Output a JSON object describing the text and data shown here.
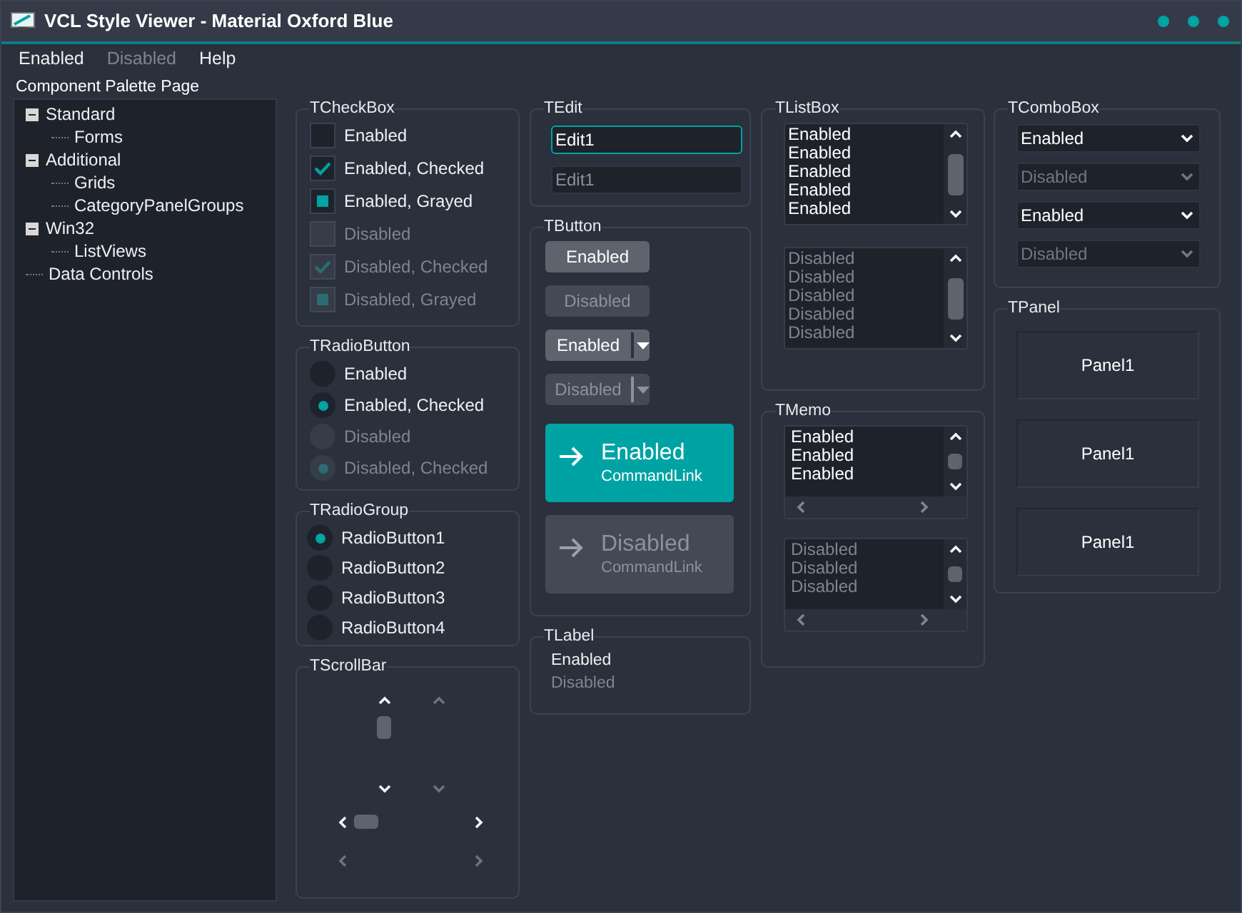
{
  "window": {
    "title": "VCL Style Viewer - Material Oxford Blue"
  },
  "menu": [
    {
      "label": "Enabled",
      "disabled": false
    },
    {
      "label": "Disabled",
      "disabled": true
    },
    {
      "label": "Help",
      "disabled": false
    }
  ],
  "tree": {
    "title": "Component Palette Page",
    "items": [
      {
        "label": "Standard",
        "expanded": true,
        "children": [
          {
            "label": "Forms"
          }
        ]
      },
      {
        "label": "Additional",
        "expanded": true,
        "children": [
          {
            "label": "Grids"
          },
          {
            "label": "CategoryPanelGroups"
          }
        ]
      },
      {
        "label": "Win32",
        "expanded": true,
        "children": [
          {
            "label": "ListViews"
          }
        ]
      },
      {
        "label": "Data Controls"
      }
    ]
  },
  "checkboxes": {
    "title": "TCheckBox",
    "items": [
      {
        "label": "Enabled",
        "checked": false,
        "grayed": false,
        "disabled": false
      },
      {
        "label": "Enabled, Checked",
        "checked": true,
        "grayed": false,
        "disabled": false
      },
      {
        "label": "Enabled, Grayed",
        "checked": false,
        "grayed": true,
        "disabled": false
      },
      {
        "label": "Disabled",
        "checked": false,
        "grayed": false,
        "disabled": true
      },
      {
        "label": "Disabled, Checked",
        "checked": true,
        "grayed": false,
        "disabled": true
      },
      {
        "label": "Disabled, Grayed",
        "checked": false,
        "grayed": true,
        "disabled": true
      }
    ]
  },
  "radio_buttons": {
    "title": "TRadioButton",
    "items": [
      {
        "label": "Enabled",
        "selected": false,
        "disabled": false
      },
      {
        "label": "Enabled, Checked",
        "selected": true,
        "disabled": false
      },
      {
        "label": "Disabled",
        "selected": false,
        "disabled": true
      },
      {
        "label": "Disabled, Checked",
        "selected": true,
        "disabled": true
      }
    ]
  },
  "radio_group": {
    "title": "TRadioGroup",
    "items": [
      {
        "label": "RadioButton1",
        "selected": true
      },
      {
        "label": "RadioButton2",
        "selected": false
      },
      {
        "label": "RadioButton3",
        "selected": false
      },
      {
        "label": "RadioButton4",
        "selected": false
      }
    ]
  },
  "scroll_bars": {
    "title": "TScrollBar",
    "vertical": [
      {
        "disabled": false
      },
      {
        "disabled": true
      }
    ],
    "horizontal": [
      {
        "disabled": false
      },
      {
        "disabled": true
      }
    ]
  },
  "edits": {
    "title": "TEdit",
    "items": [
      {
        "value": "Edit1",
        "focused": true,
        "disabled": false
      },
      {
        "value": "Edit1",
        "focused": false,
        "disabled": true
      }
    ]
  },
  "buttons": {
    "title": "TButton",
    "items": [
      {
        "kind": "push",
        "label": "Enabled",
        "disabled": false
      },
      {
        "kind": "push",
        "label": "Disabled",
        "disabled": true
      },
      {
        "kind": "split",
        "label": "Enabled",
        "disabled": false
      },
      {
        "kind": "split",
        "label": "Disabled",
        "disabled": true
      },
      {
        "kind": "command_link",
        "label": "Enabled",
        "note": "CommandLink",
        "disabled": false
      },
      {
        "kind": "command_link",
        "label": "Disabled",
        "note": "CommandLink",
        "disabled": true
      }
    ]
  },
  "labels": {
    "title": "TLabel",
    "items": [
      {
        "text": "Enabled",
        "disabled": false
      },
      {
        "text": "Disabled",
        "disabled": true
      }
    ]
  },
  "list_boxes": {
    "title": "TListBox",
    "items": [
      {
        "disabled": false,
        "lines": [
          "Enabled",
          "Enabled",
          "Enabled",
          "Enabled",
          "Enabled"
        ]
      },
      {
        "disabled": true,
        "lines": [
          "Disabled",
          "Disabled",
          "Disabled",
          "Disabled",
          "Disabled"
        ]
      }
    ]
  },
  "memos": {
    "title": "TMemo",
    "items": [
      {
        "disabled": false,
        "lines": [
          "Enabled",
          "Enabled",
          "Enabled"
        ]
      },
      {
        "disabled": true,
        "lines": [
          "Disabled",
          "Disabled",
          "Disabled"
        ]
      }
    ]
  },
  "combo_boxes": {
    "title": "TComboBox",
    "items": [
      {
        "value": "Enabled",
        "disabled": false
      },
      {
        "value": "Disabled",
        "disabled": true
      },
      {
        "value": "Enabled",
        "disabled": false
      },
      {
        "value": "Disabled",
        "disabled": true
      }
    ]
  },
  "panels": {
    "title": "TPanel",
    "items": [
      {
        "caption": "Panel1"
      },
      {
        "caption": "Panel1"
      },
      {
        "caption": "Panel1"
      }
    ]
  }
}
